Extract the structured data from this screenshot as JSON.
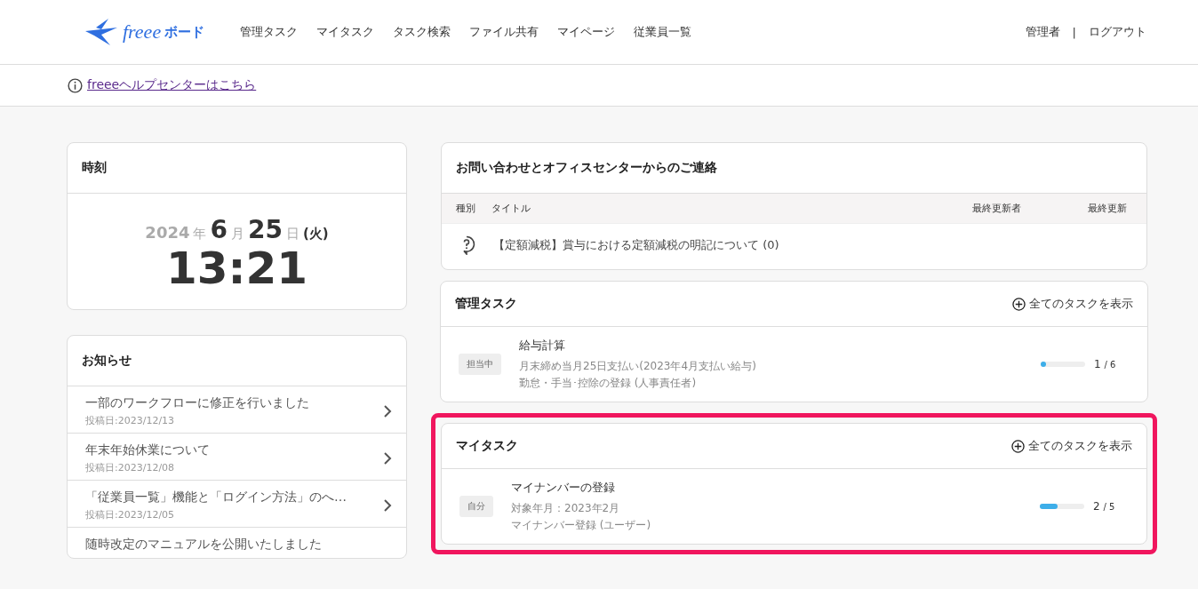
{
  "header": {
    "logo_text": "freee",
    "logo_suffix": "ボード",
    "nav": [
      "管理タスク",
      "マイタスク",
      "タスク検索",
      "ファイル共有",
      "マイページ",
      "従業員一覧"
    ],
    "user": "管理者",
    "separator": "|",
    "logout": "ログアウト"
  },
  "help_link": "freeeヘルプセンターはこちら",
  "clock": {
    "title": "時刻",
    "year": "2024",
    "year_unit": "年",
    "month": "6",
    "month_unit": "月",
    "day": "25",
    "day_unit": "日",
    "weekday": "(火)",
    "time": "13:21"
  },
  "notices": {
    "title": "お知らせ",
    "items": [
      {
        "title": "一部のワークフローに修正を行いました",
        "date": "投稿日:2023/12/13"
      },
      {
        "title": "年末年始休業について",
        "date": "投稿日:2023/12/08"
      },
      {
        "title": "「従業員一覧」機能と「ログイン方法」のへ…",
        "date": "投稿日:2023/12/05"
      },
      {
        "title": "随時改定のマニュアルを公開いたしました"
      }
    ]
  },
  "contacts": {
    "title": "お問い合わせとオフィスセンターからのご連絡",
    "columns": [
      "種別",
      "タイトル",
      "最終更新者",
      "最終更新"
    ],
    "rows": [
      {
        "title": "【定額減税】賞与における定額減税の明記について (0)"
      }
    ]
  },
  "task_panels": [
    {
      "title": "管理タスク",
      "link": "全てのタスクを表示",
      "highlighted": false,
      "tasks": [
        {
          "badge": "担当中",
          "name": "給与計算",
          "details": [
            "月末締め当月25日支払い(2023年4月支払い給与)",
            "勤怠・手当･控除の登録 (人事責任者)"
          ],
          "level": 0.1,
          "done": "1",
          "total": "/ 6"
        }
      ]
    },
    {
      "title": "マイタスク",
      "link": "全てのタスクを表示",
      "highlighted": true,
      "tasks": [
        {
          "badge": "自分",
          "name": "マイナンバーの登録",
          "details": [
            "対象年月：2023年2月",
            "マイナンバー登録 (ユーザー)"
          ],
          "level": 0.4,
          "done": "2",
          "total": "/ 5"
        }
      ]
    }
  ]
}
